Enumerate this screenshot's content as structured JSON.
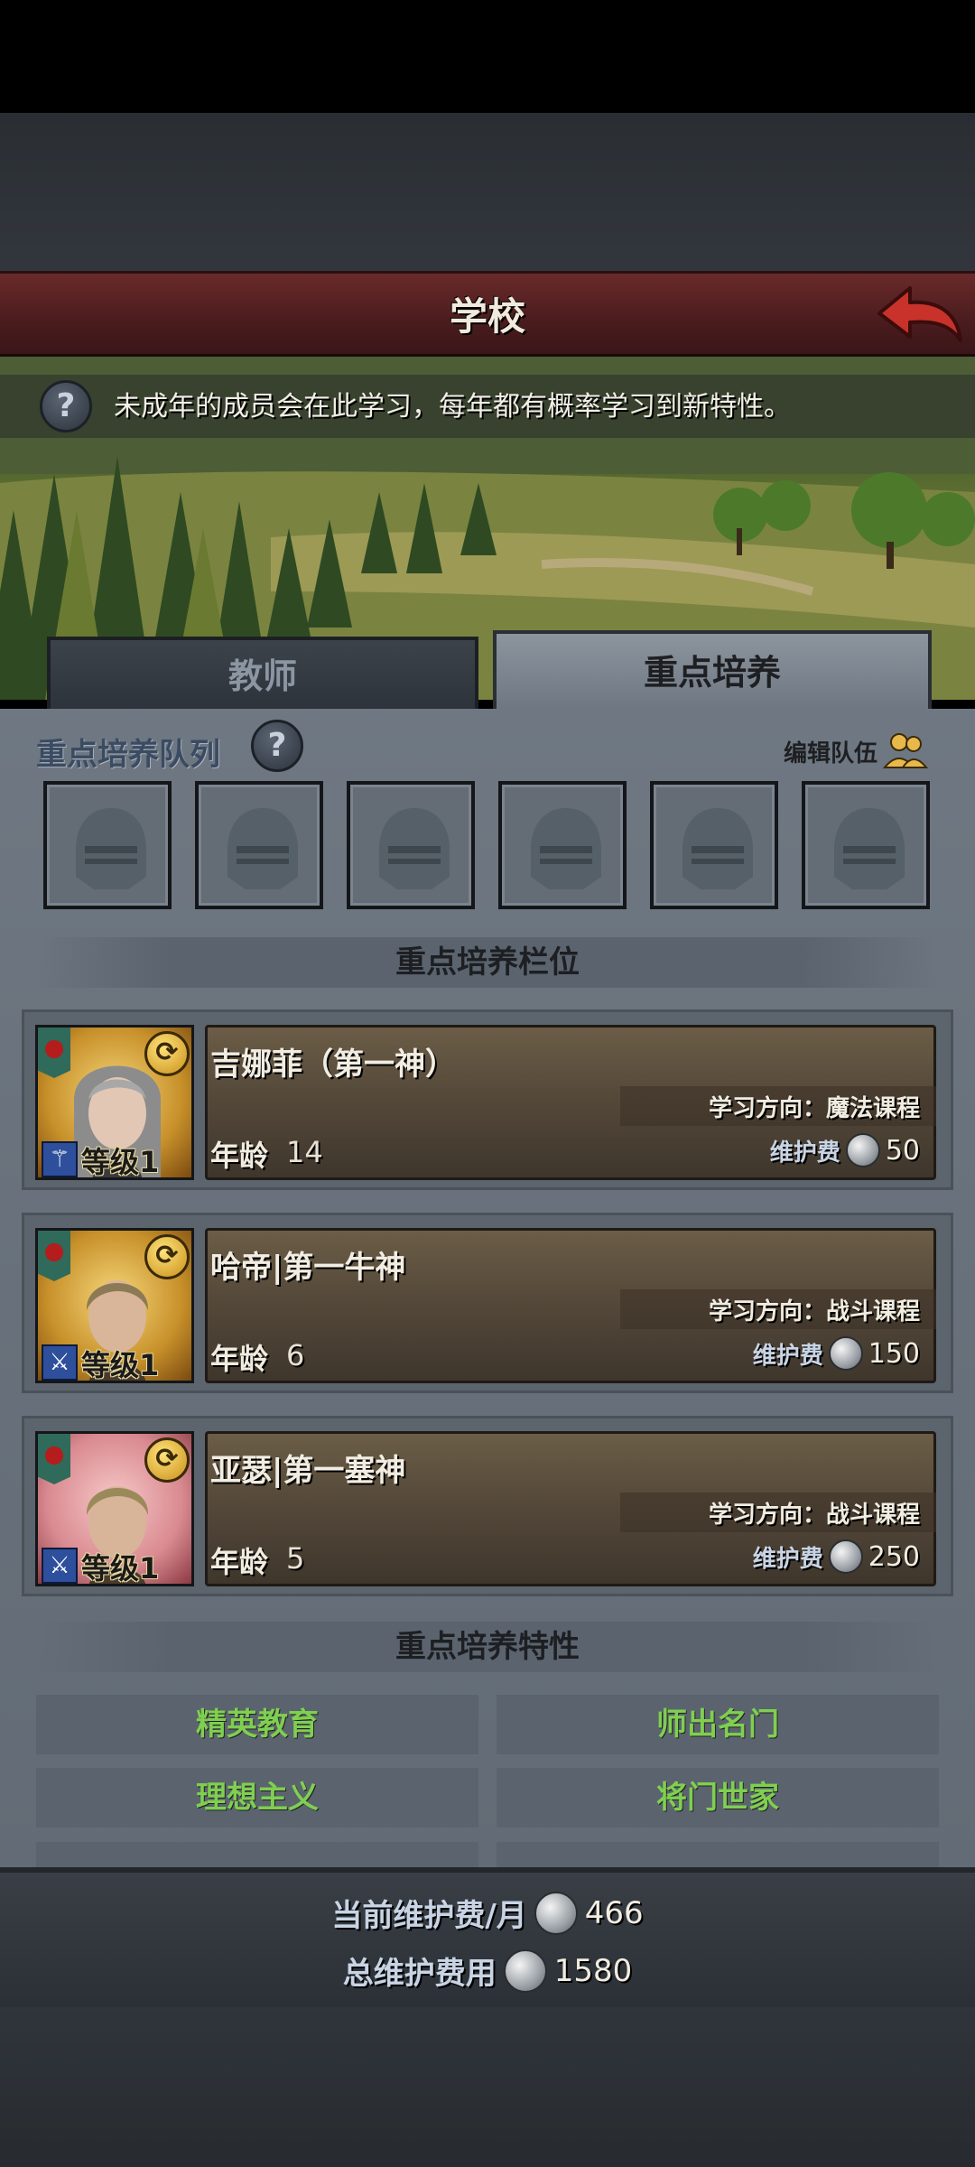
{
  "header": {
    "title": "学校"
  },
  "info": {
    "text": "未成年的成员会在此学习，每年都有概率学习到新特性。"
  },
  "tabs": [
    {
      "label": "教师",
      "active": false
    },
    {
      "label": "重点培养",
      "active": true
    }
  ],
  "queue": {
    "label": "重点培养队列",
    "edit_label": "编辑队伍",
    "slot_count": 6
  },
  "slots_section": {
    "title": "重点培养栏位"
  },
  "students": [
    {
      "name": "吉娜菲（第一神）",
      "direction": "学习方向：魔法课程",
      "level": "等级1",
      "age_label": "年龄",
      "age": "14",
      "fee_label": "维护费",
      "fee": "50",
      "frame": "gold"
    },
    {
      "name": "哈帝|第一牛神",
      "direction": "学习方向：战斗课程",
      "level": "等级1",
      "age_label": "年龄",
      "age": "6",
      "fee_label": "维护费",
      "fee": "150",
      "frame": "gold"
    },
    {
      "name": "亚瑟|第一塞神",
      "direction": "学习方向：战斗课程",
      "level": "等级1",
      "age_label": "年龄",
      "age": "5",
      "fee_label": "维护费",
      "fee": "250",
      "frame": "pink"
    }
  ],
  "traits_section": {
    "title": "重点培养特性"
  },
  "traits": [
    "精英教育",
    "师出名门",
    "理想主义",
    "将门世家"
  ],
  "footer": {
    "monthly_label": "当前维护费/月",
    "monthly_value": "466",
    "total_label": "总维护费用",
    "total_value": "1580"
  },
  "colors": {
    "trait_text": "#7fcf50",
    "title_bar": "#4a1c1e",
    "back_arrow": "#c8322a"
  }
}
